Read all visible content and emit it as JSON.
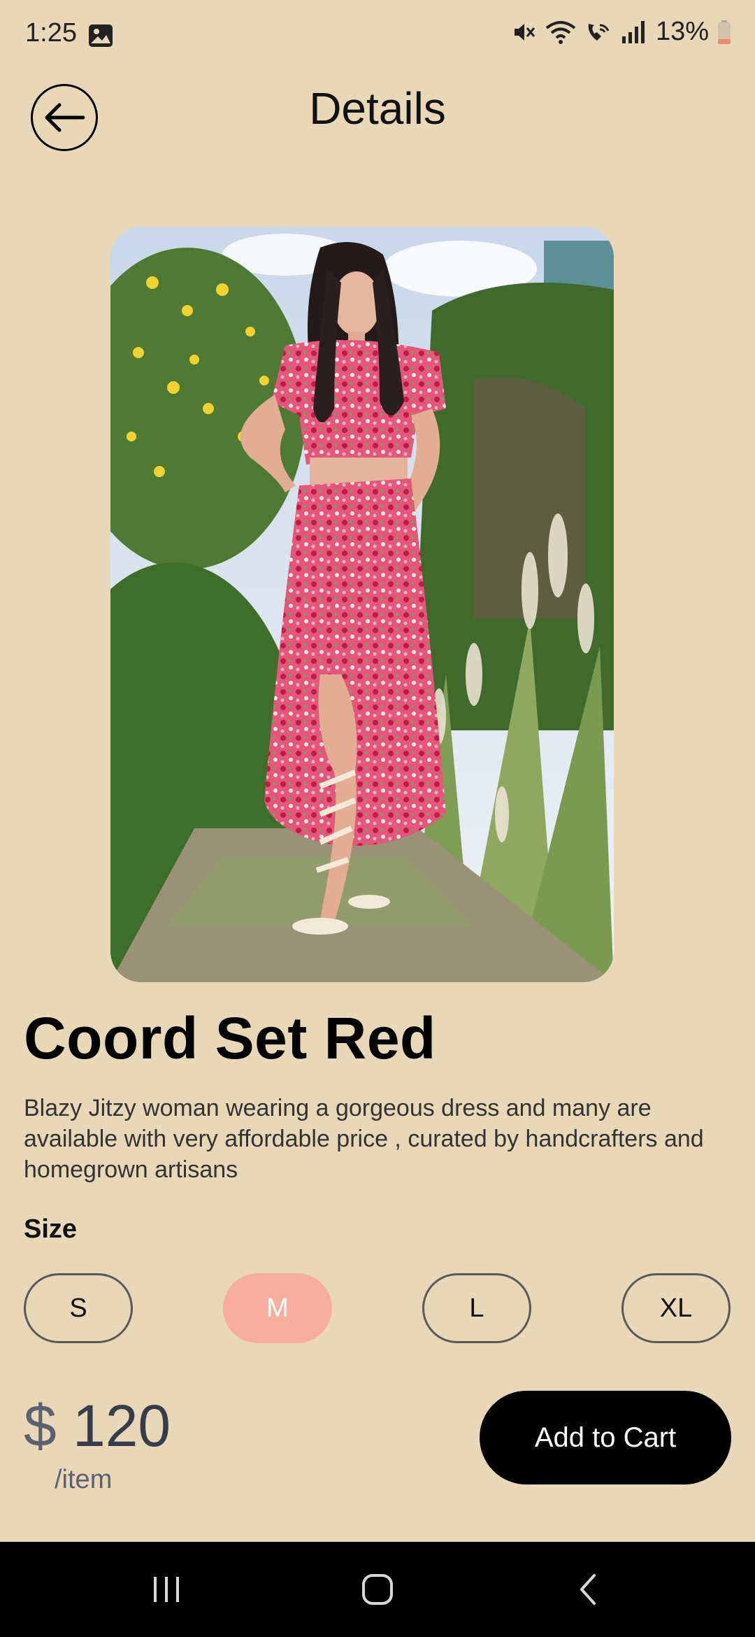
{
  "status_bar": {
    "time": "1:25",
    "battery": "13%",
    "icons": [
      "gallery-icon",
      "mute-icon",
      "wifi-icon",
      "wifi-calling-icon",
      "signal-icon",
      "battery-icon"
    ]
  },
  "header": {
    "title": "Details",
    "back_icon": "arrow-left-icon"
  },
  "product": {
    "name": "Coord Set Red",
    "description": "Blazy Jitzy woman wearing a gorgeous dress and many are available with very affordable price , curated by handcrafters and homegrown artisans",
    "size_label": "Size",
    "sizes": [
      {
        "label": "S",
        "selected": false
      },
      {
        "label": "M",
        "selected": true
      },
      {
        "label": "L",
        "selected": false
      },
      {
        "label": "XL",
        "selected": false
      }
    ],
    "price_currency": "$",
    "price_value": "120",
    "price_unit": "/item"
  },
  "actions": {
    "add_to_cart": "Add to Cart"
  },
  "colors": {
    "background": "#E8D8B8",
    "selected_size": "#F8AE9E",
    "button": "#000000",
    "price": "#363D4A"
  },
  "nav_bar": {
    "icons": [
      "recents-icon",
      "home-icon",
      "back-nav-icon"
    ]
  }
}
